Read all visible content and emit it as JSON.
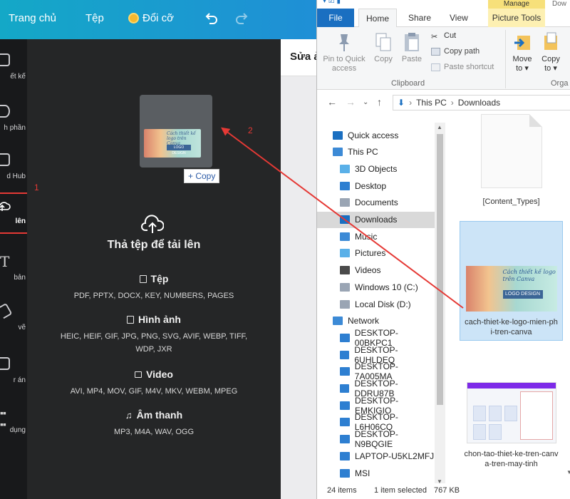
{
  "canva": {
    "topbar": {
      "home": "Trang chủ",
      "file": "Tệp",
      "resize": "Đổi cỡ"
    },
    "rail": [
      {
        "label": "ết kế",
        "icon": "layout-icon"
      },
      {
        "label": "h phần",
        "icon": "elements-icon"
      },
      {
        "label": "d Hub",
        "icon": "brand-hub-icon"
      },
      {
        "label": "lên",
        "icon": "upload-icon",
        "active": true
      },
      {
        "label": "bản",
        "icon": "text-icon"
      },
      {
        "label": "vẽ",
        "icon": "draw-icon"
      },
      {
        "label": "r án",
        "icon": "projects-icon"
      },
      {
        "label": "dụng",
        "icon": "apps-icon"
      }
    ],
    "drag_copy": "+ Copy",
    "drop_title": "Thả tệp để tải lên",
    "types": [
      {
        "title": "Tệp",
        "desc": "PDF, PPTX, DOCX, KEY, NUMBERS, PAGES"
      },
      {
        "title": "Hình ảnh",
        "desc": "HEIC, HEIF, GIF, JPG, PNG, SVG, AVIF, WEBP, TIFF, WDP, JXR"
      },
      {
        "title": "Video",
        "desc": "AVI, MP4, MOV, GIF, M4V, MKV, WEBM, MPEG"
      },
      {
        "title": "Âm thanh",
        "desc": "MP3, M4A, WAV, OGG"
      }
    ],
    "right_title": "Sửa ả",
    "thumb_text": "Cách thiết kế logo trên Canva",
    "thumb_badge": "LOGO DESIGN"
  },
  "explorer": {
    "manage": "Manage",
    "dow": "Dow",
    "tabs": {
      "file": "File",
      "home": "Home",
      "share": "Share",
      "view": "View",
      "pictools": "Picture Tools"
    },
    "ribbon": {
      "pin": "Pin to Quick access",
      "copy": "Copy",
      "paste": "Paste",
      "cut": "Cut",
      "copy_path": "Copy path",
      "paste_shortcut": "Paste shortcut",
      "clipboard": "Clipboard",
      "move_to": "Move to",
      "copy_to": "Copy to",
      "organize": "Orga"
    },
    "address": {
      "pc": "This PC",
      "folder": "Downloads"
    },
    "nav": [
      {
        "label": "Quick access",
        "icon": "star-icon",
        "indent": 0
      },
      {
        "label": "This PC",
        "icon": "computer-icon",
        "indent": 0
      },
      {
        "label": "3D Objects",
        "icon": "3d-objects-icon",
        "indent": 1
      },
      {
        "label": "Desktop",
        "icon": "desktop-folder-icon",
        "indent": 1
      },
      {
        "label": "Documents",
        "icon": "documents-icon",
        "indent": 1
      },
      {
        "label": "Downloads",
        "icon": "downloads-icon",
        "indent": 1,
        "selected": true
      },
      {
        "label": "Music",
        "icon": "music-icon",
        "indent": 1
      },
      {
        "label": "Pictures",
        "icon": "pictures-icon",
        "indent": 1
      },
      {
        "label": "Videos",
        "icon": "videos-icon",
        "indent": 1
      },
      {
        "label": "Windows 10 (C:)",
        "icon": "drive-icon",
        "indent": 1
      },
      {
        "label": "Local Disk (D:)",
        "icon": "drive-icon",
        "indent": 1
      },
      {
        "label": "Network",
        "icon": "network-icon",
        "indent": 0
      },
      {
        "label": "DESKTOP-00BKPC1",
        "icon": "monitor-icon",
        "indent": 1
      },
      {
        "label": "DESKTOP-6UHLDEQ",
        "icon": "monitor-icon",
        "indent": 1
      },
      {
        "label": "DESKTOP-7A005MA",
        "icon": "monitor-icon",
        "indent": 1
      },
      {
        "label": "DESKTOP-DDRU87B",
        "icon": "monitor-icon",
        "indent": 1
      },
      {
        "label": "DESKTOP-EMKIGIO",
        "icon": "monitor-icon",
        "indent": 1
      },
      {
        "label": "DESKTOP-L6H06CQ",
        "icon": "monitor-icon",
        "indent": 1
      },
      {
        "label": "DESKTOP-N9BQGIE",
        "icon": "monitor-icon",
        "indent": 1
      },
      {
        "label": "LAPTOP-U5KL2MFJ",
        "icon": "monitor-icon",
        "indent": 1
      },
      {
        "label": "MSI",
        "icon": "monitor-icon",
        "indent": 1
      }
    ],
    "files": [
      {
        "name": "[Content_Types]",
        "kind": "doc"
      },
      {
        "name": "cach-thiet-ke-logo-mien-phi-tren-canva",
        "kind": "image",
        "selected": true
      },
      {
        "name": "chon-tao-thiet-ke-tren-canva-tren-may-tinh",
        "kind": "screenshot"
      }
    ],
    "status": {
      "items": "24 items",
      "selected": "1 item selected",
      "size": "767 KB"
    }
  },
  "annotations": {
    "step1": "1",
    "step2": "2",
    "color": "#e53935"
  }
}
